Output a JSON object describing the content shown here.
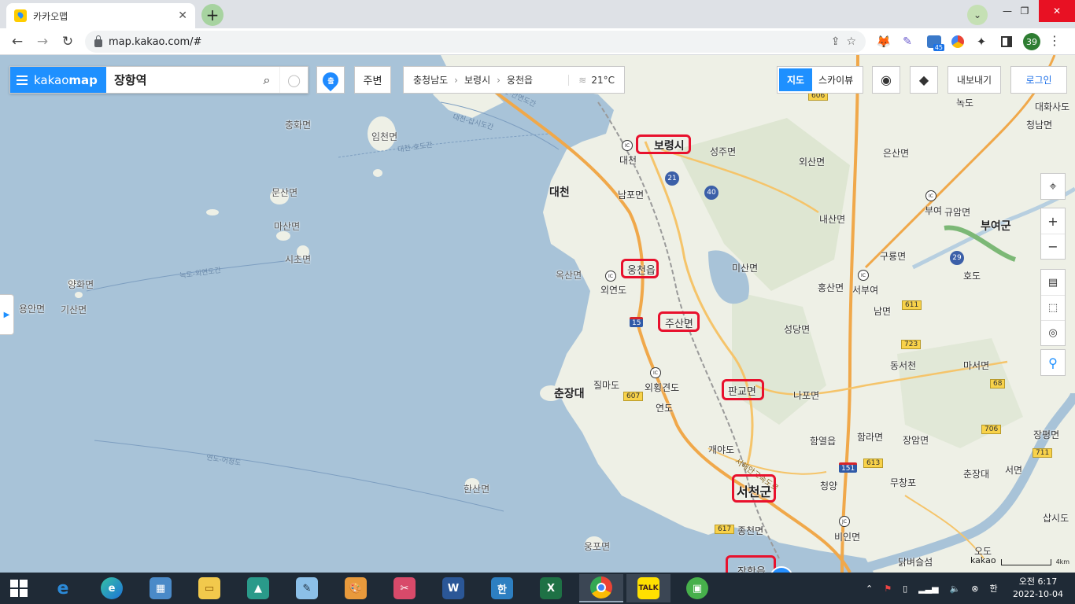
{
  "browser": {
    "tab_title": "카카오맵",
    "tab_close": "✕",
    "new_tab": "+",
    "url": "map.kakao.com/#",
    "profile_initial": "39",
    "ext_badge_count": "45",
    "window_min": "—",
    "window_restore": "❐",
    "window_close": "✕"
  },
  "kakao": {
    "brand_prefix": "kakao",
    "brand_suffix": "map",
    "search_query": "장항역",
    "nearby_label": "주변",
    "breadcrumb": [
      "충청남도",
      "보령시",
      "웅천읍"
    ],
    "temperature": "21°C",
    "mode_map": "지도",
    "mode_sky": "스카이뷰",
    "export_label": "내보내기",
    "login_label": "로그인",
    "pin_mark": "출",
    "scale_label": "kakao",
    "scale_value": "4km",
    "marker_label": "A"
  },
  "map": {
    "highlighted_places": [
      "보령시",
      "웅천읍",
      "주산면",
      "판교면",
      "서천군",
      "장항읍"
    ],
    "place_labels": [
      "대천",
      "남포면",
      "성주면",
      "외산면",
      "은산면",
      "청남면",
      "부여",
      "규암면",
      "부여군",
      "내산면",
      "구룡면",
      "홍산면",
      "서부여",
      "미산면",
      "남면",
      "옥산면",
      "충화면",
      "임천면",
      "문산면",
      "마산면",
      "시초면",
      "양화면",
      "용안면",
      "기산면",
      "한산면",
      "웅포면",
      "성당면",
      "동서천",
      "마서면",
      "나포면",
      "함라면",
      "함열읍",
      "장암면",
      "장평면",
      "청양",
      "무창포",
      "춘장대",
      "서면",
      "비인면",
      "종천면",
      "닭벼슬섬",
      "오도",
      "삽시도",
      "호도",
      "녹도",
      "대화사도",
      "외연도",
      "외횡견도",
      "질마도",
      "연도",
      "개야도",
      "춘장대",
      "대천"
    ],
    "route_labels": [
      "대천-삽시도간",
      "대천-호도간",
      "녹도-외연도간",
      "연도-어청도",
      "대천-안면도간",
      "서해안고속도로"
    ],
    "road_numbers": [
      "15",
      "21",
      "40",
      "29",
      "606",
      "607",
      "611",
      "613",
      "617",
      "68",
      "706",
      "711",
      "723",
      "151"
    ]
  },
  "taskbar": {
    "time": "오전 6:17",
    "date": "2022-10-04",
    "ime": "한"
  }
}
